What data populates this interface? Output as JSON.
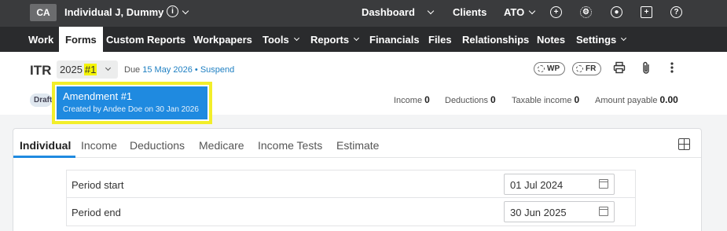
{
  "topbar": {
    "avatar_initials": "CA",
    "client_name": "Individual J, Dummy",
    "info_icon": "i",
    "links": {
      "dashboard": "Dashboard",
      "clients": "Clients",
      "ato": "ATO"
    },
    "icons": [
      "plus-circle-icon",
      "gear-icon",
      "user-circle-icon",
      "gift-icon",
      "help-circle-icon"
    ]
  },
  "nav": {
    "items": [
      {
        "label": "Work"
      },
      {
        "label": "Forms"
      },
      {
        "label": "Custom Reports"
      },
      {
        "label": "Workpapers"
      },
      {
        "label": "Tools"
      },
      {
        "label": "Reports"
      },
      {
        "label": "Financials"
      },
      {
        "label": "Files"
      },
      {
        "label": "Relationships"
      },
      {
        "label": "Notes"
      },
      {
        "label": "Settings"
      }
    ],
    "active": "Forms"
  },
  "header": {
    "form_type": "ITR",
    "year": "2025",
    "amendment_tag": "#1",
    "due_label": "Due",
    "due_date": "15 May 2026",
    "separator": "•",
    "suspend_link": "Suspend",
    "wp_pill": "WP",
    "fr_pill": "FR",
    "status_badge": "Draft"
  },
  "summary": {
    "income_label": "Income",
    "income_value": "0",
    "deductions_label": "Deductions",
    "deductions_value": "0",
    "taxable_label": "Taxable income",
    "taxable_value": "0",
    "payable_label": "Amount payable",
    "payable_value": "0.00"
  },
  "dropdown": {
    "item_title": "Amendment #1",
    "item_subtitle": "Created by Andee Doe on 30 Jan 2026"
  },
  "tabs": {
    "items": [
      "Individual",
      "Income",
      "Deductions",
      "Medicare",
      "Income Tests",
      "Estimate"
    ],
    "active": "Individual"
  },
  "fields": {
    "period_start_label": "Period start",
    "period_start_value": "01 Jul 2024",
    "period_end_label": "Period end",
    "period_end_value": "30 Jun 2025"
  },
  "colors": {
    "accent": "#1f8ae0",
    "highlight": "#f4f400",
    "topbar": "#3a3b3d",
    "navbar": "#2a2b2d"
  }
}
